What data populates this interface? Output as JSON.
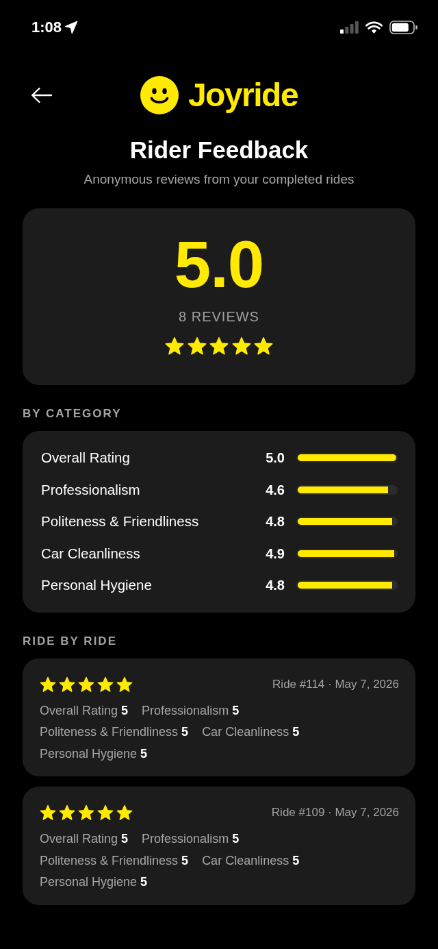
{
  "status_bar": {
    "time": "1:08"
  },
  "header": {
    "brand": "Joyride",
    "title": "Rider Feedback",
    "subtitle": "Anonymous reviews from your completed rides"
  },
  "summary": {
    "score": "5.0",
    "count": "8 REVIEWS",
    "stars": 5
  },
  "category_section": {
    "heading": "BY CATEGORY",
    "categories": [
      {
        "name": "Overall Rating",
        "score": "5.0",
        "level": 1.0
      },
      {
        "name": "Professionalism",
        "score": "4.6",
        "level": 0.92
      },
      {
        "name": "Politeness & Friendliness",
        "score": "4.8",
        "level": 0.96
      },
      {
        "name": "Car Cleanliness",
        "score": "4.9",
        "level": 0.98
      },
      {
        "name": "Personal Hygiene",
        "score": "4.8",
        "level": 0.96
      }
    ]
  },
  "ride_section": {
    "heading": "RIDE BY RIDE",
    "rides": [
      {
        "stars": 5,
        "meta": "Ride #114 · May 7, 2026",
        "ratings": [
          {
            "label": "Overall Rating",
            "value": "5"
          },
          {
            "label": "Professionalism",
            "value": "5"
          },
          {
            "label": "Politeness & Friendliness",
            "value": "5"
          },
          {
            "label": "Car Cleanliness",
            "value": "5"
          },
          {
            "label": "Personal Hygiene",
            "value": "5"
          }
        ]
      },
      {
        "stars": 5,
        "meta": "Ride #109 · May 7, 2026",
        "ratings": [
          {
            "label": "Overall Rating",
            "value": "5"
          },
          {
            "label": "Professionalism",
            "value": "5"
          },
          {
            "label": "Politeness & Friendliness",
            "value": "5"
          },
          {
            "label": "Car Cleanliness",
            "value": "5"
          },
          {
            "label": "Personal Hygiene",
            "value": "5"
          }
        ]
      }
    ]
  }
}
